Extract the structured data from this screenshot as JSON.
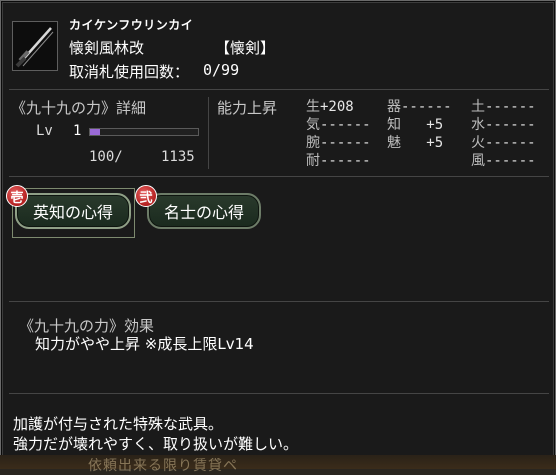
{
  "item": {
    "katakana": "カイケンフウリンカイ",
    "name": "懐剣風林改",
    "category": "【懐剣】",
    "usage_label": "取消札使用回数：",
    "usage_value": "0/99",
    "icon": "dagger-icon"
  },
  "detail": {
    "title": "《九十九の力》詳細",
    "lv_label": "Lv",
    "lv_value": "1",
    "exp_current": "100/",
    "exp_max": "1135",
    "exp_fraction": 0.088
  },
  "ability": {
    "title": "能力上昇",
    "stats": [
      {
        "key": "生",
        "value": "+208"
      },
      {
        "key": "器",
        "value": "------"
      },
      {
        "key": "土",
        "value": "------"
      },
      {
        "key": "気",
        "value": "------"
      },
      {
        "key": "知",
        "value": "   +5"
      },
      {
        "key": "水",
        "value": "------"
      },
      {
        "key": "腕",
        "value": "------"
      },
      {
        "key": "魅",
        "value": "   +5"
      },
      {
        "key": "火",
        "value": "------"
      },
      {
        "key": "耐",
        "value": "------"
      },
      {
        "key": "風",
        "value": "------"
      }
    ]
  },
  "skills": [
    {
      "badge": "壱",
      "label": "英知の心得"
    },
    {
      "badge": "弐",
      "label": "名士の心得"
    }
  ],
  "effect": {
    "title": "《九十九の力》効果",
    "text": "知力がやや上昇 ※成長上限Lv14"
  },
  "description": {
    "line1": "加護が付与された特殊な武具。",
    "line2": "強力だが壊れやすく、取り扱いが難しい。"
  },
  "background_text": "依頼出来る限り賃貸ペ",
  "colors": {
    "badge": "#c42a2a",
    "exp_bar": "#9a6ad6",
    "button_border": "#6d7c68"
  }
}
